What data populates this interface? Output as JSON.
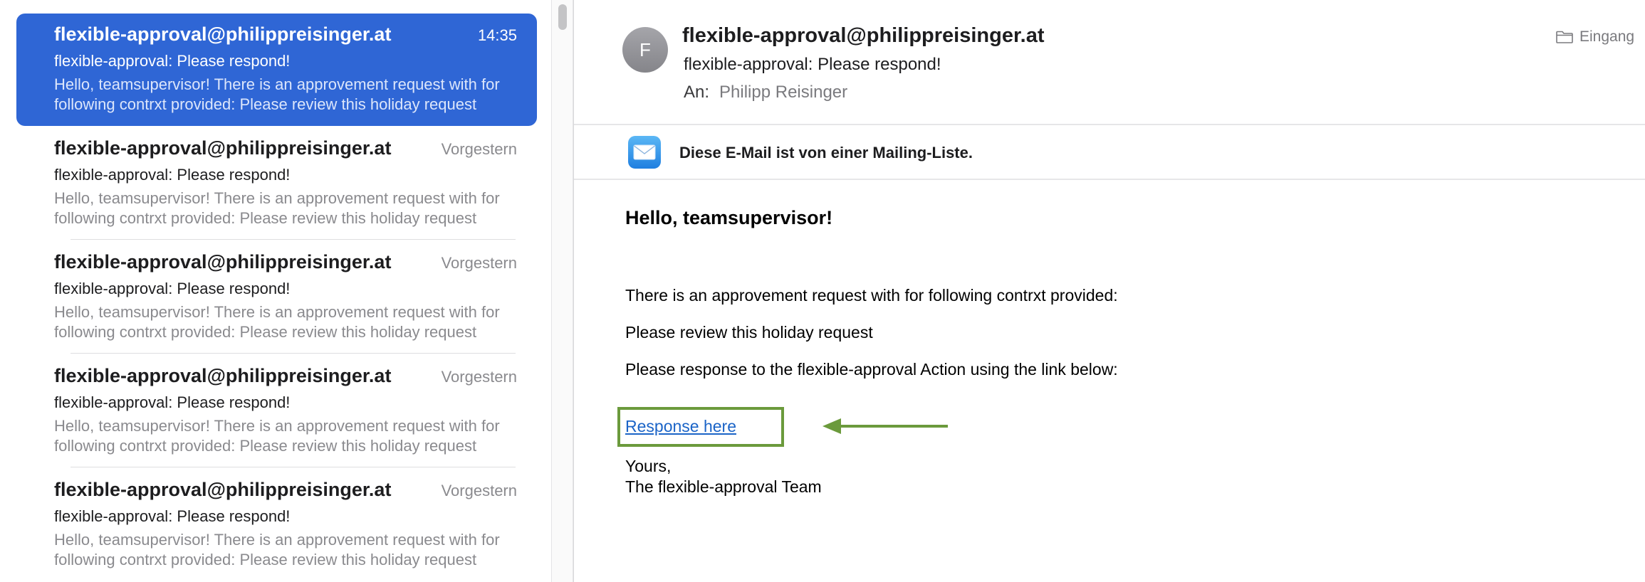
{
  "message_list": [
    {
      "sender": "flexible-approval@philippreisinger.at",
      "time": "14:35",
      "subject": "flexible-approval: Please respond!",
      "preview": "Hello, teamsupervisor! There is an approvement request with for following contrxt provided: Please review this holiday request",
      "selected": true
    },
    {
      "sender": "flexible-approval@philippreisinger.at",
      "time": "Vorgestern",
      "subject": "flexible-approval: Please respond!",
      "preview": "Hello, teamsupervisor! There is an approvement request with for following contrxt provided: Please review this holiday request",
      "selected": false
    },
    {
      "sender": "flexible-approval@philippreisinger.at",
      "time": "Vorgestern",
      "subject": "flexible-approval: Please respond!",
      "preview": "Hello, teamsupervisor! There is an approvement request with for following contrxt provided: Please review this holiday request",
      "selected": false
    },
    {
      "sender": "flexible-approval@philippreisinger.at",
      "time": "Vorgestern",
      "subject": "flexible-approval: Please respond!",
      "preview": "Hello, teamsupervisor! There is an approvement request with for following contrxt provided: Please review this holiday request",
      "selected": false
    },
    {
      "sender": "flexible-approval@philippreisinger.at",
      "time": "Vorgestern",
      "subject": "flexible-approval: Please respond!",
      "preview": "Hello, teamsupervisor! There is an approvement request with for following contrxt provided: Please review this holiday request",
      "selected": false
    }
  ],
  "email": {
    "avatar_initial": "F",
    "from": "flexible-approval@philippreisinger.at",
    "subject": "flexible-approval: Please respond!",
    "to_label": "An:",
    "to": "Philipp Reisinger",
    "mailbox": "Eingang",
    "mailbox_icon": "folder-icon",
    "banner_icon": "envelope-icon",
    "banner_text": "Diese E-Mail ist von einer Mailing-Liste.",
    "body": {
      "greeting": "Hello, teamsupervisor!",
      "line1": "There is an approvement request with for following contrxt provided:",
      "line2": "Please review this holiday request",
      "line3": "Please response to the flexible-approval Action using the link below:",
      "link_text": "Response here",
      "closing_1": "Yours,",
      "closing_2": "The flexible-approval Team"
    }
  },
  "colors": {
    "selected_row": "#2f66d5",
    "annotation": "#6b9a3c",
    "link": "#1b64c7"
  }
}
